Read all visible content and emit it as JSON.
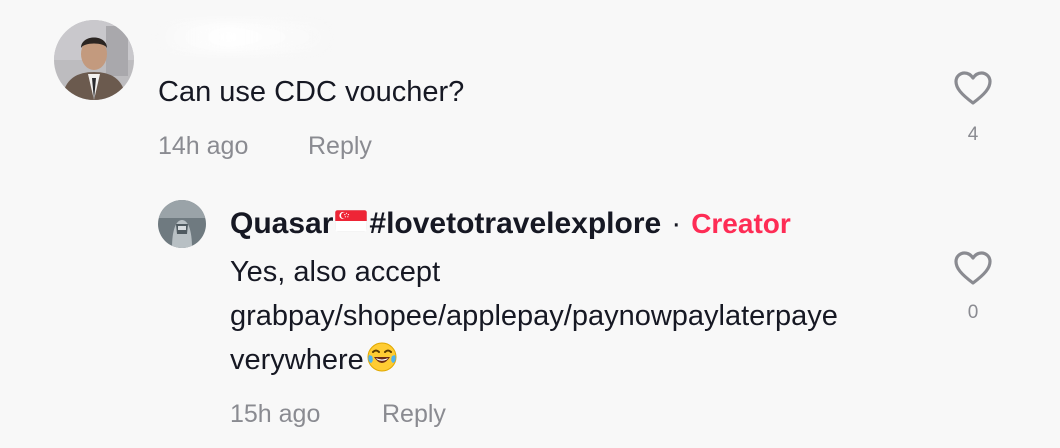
{
  "comment": {
    "text": "Can use CDC voucher?",
    "time": "14h ago",
    "reply_label": "Reply",
    "like_count": "4"
  },
  "reply": {
    "username": "Quasar",
    "hashtag": "#lovetotravelexplore",
    "separator": "·",
    "badge": "Creator",
    "text_line1": "Yes, also accept",
    "text_line2": "grabpay/shopee/applepay/paynowpaylaterpaye",
    "text_line3": "verywhere",
    "time": "15h ago",
    "reply_label": "Reply",
    "like_count": "0"
  },
  "icons": {
    "like": "heart-outline-icon",
    "flag": "singapore-flag-icon",
    "emoji": "tears-of-joy-emoji-icon"
  },
  "colors": {
    "text": "#161823",
    "secondary": "#8a8b91",
    "creator": "#fe2c55",
    "background": "#f8f8f8"
  }
}
